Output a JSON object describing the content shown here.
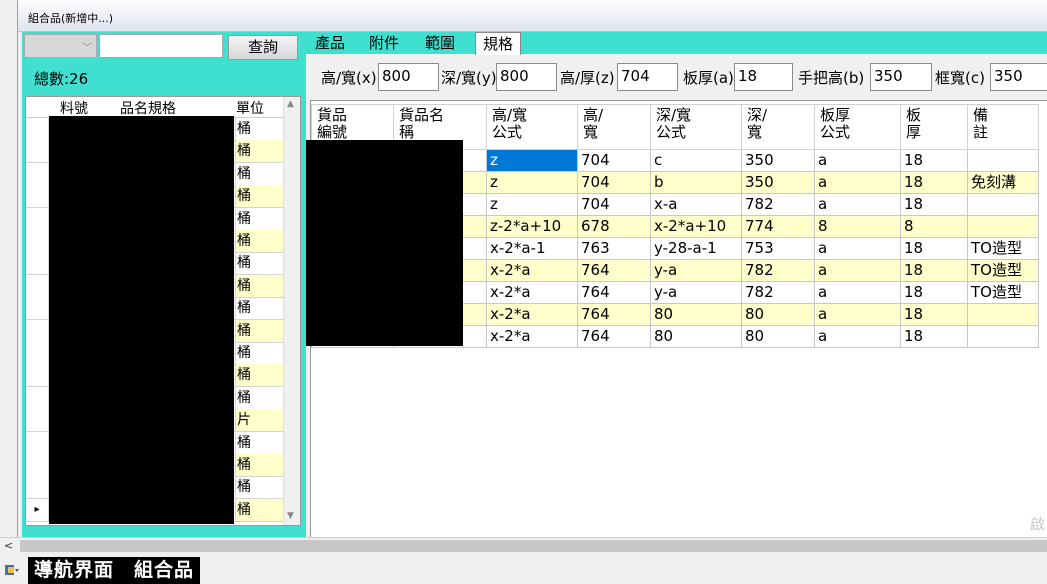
{
  "window": {
    "title": "組合品(新增中...)"
  },
  "left": {
    "combo_value": "",
    "search_value": "",
    "query_label": "查詢",
    "count_label": "總數:26",
    "columns": [
      "料號",
      "品名規格",
      "單位"
    ],
    "rows": [
      {
        "unit": "桶",
        "yellow": false
      },
      {
        "unit": "桶",
        "yellow": true
      },
      {
        "unit": "桶",
        "yellow": false
      },
      {
        "unit": "桶",
        "yellow": true
      },
      {
        "unit": "桶",
        "yellow": false
      },
      {
        "unit": "桶",
        "yellow": true
      },
      {
        "unit": "桶",
        "yellow": false
      },
      {
        "unit": "桶",
        "yellow": true
      },
      {
        "unit": "桶",
        "yellow": false
      },
      {
        "unit": "桶",
        "yellow": true
      },
      {
        "unit": "桶",
        "yellow": false
      },
      {
        "unit": "桶",
        "yellow": true
      },
      {
        "unit": "桶",
        "yellow": false
      },
      {
        "unit": "片",
        "yellow": true
      },
      {
        "unit": "桶",
        "yellow": false
      },
      {
        "unit": "桶",
        "yellow": true
      },
      {
        "unit": "桶",
        "yellow": false
      },
      {
        "unit": "桶",
        "yellow": true
      }
    ],
    "current_row_marker": "▸"
  },
  "tabs": [
    "產品",
    "附件",
    "範圍",
    "規格"
  ],
  "selected_tab": "規格",
  "params": {
    "height_label": "高/寬(x)",
    "height_value": "800",
    "depth_label": "深/寬(y)",
    "depth_value": "800",
    "thick_label": "高/厚(z)",
    "thick_value": "704",
    "board_label": "板厚(a)",
    "board_value": "18",
    "handle_label": "手把高(b)",
    "handle_value": "350",
    "frame_label": "框寬(c)",
    "frame_value": "350"
  },
  "grid": {
    "headers": [
      "貨品\n編號",
      "貨品名\n稱",
      "高/寬\n公式",
      "高/\n寬",
      "深/寬\n公式",
      "深/\n寬",
      "板厚\n公式",
      "板\n厚",
      "備\n註"
    ],
    "rows": [
      {
        "hf": "z",
        "h": "704",
        "df": "c",
        "d": "350",
        "bf": "a",
        "b": "18",
        "note": "",
        "yellow": false
      },
      {
        "hf": "z",
        "h": "704",
        "df": "b",
        "d": "350",
        "bf": "a",
        "b": "18",
        "note": "免刻溝",
        "yellow": true
      },
      {
        "hf": "z",
        "h": "704",
        "df": "x-a",
        "d": "782",
        "bf": "a",
        "b": "18",
        "note": "",
        "yellow": false
      },
      {
        "hf": "z-2*a+10",
        "h": "678",
        "df": "x-2*a+10",
        "d": "774",
        "bf": "8",
        "b": "8",
        "note": "",
        "yellow": true
      },
      {
        "hf": "x-2*a-1",
        "h": "763",
        "df": "y-28-a-1",
        "d": "753",
        "bf": "a",
        "b": "18",
        "note": "TO造型",
        "yellow": false
      },
      {
        "hf": "x-2*a",
        "h": "764",
        "df": "y-a",
        "d": "782",
        "bf": "a",
        "b": "18",
        "note": "TO造型",
        "yellow": true
      },
      {
        "hf": "x-2*a",
        "h": "764",
        "df": "y-a",
        "d": "782",
        "bf": "a",
        "b": "18",
        "note": "TO造型",
        "yellow": false
      },
      {
        "hf": "x-2*a",
        "h": "764",
        "df": "80",
        "d": "80",
        "bf": "a",
        "b": "18",
        "note": "",
        "yellow": true
      },
      {
        "hf": "x-2*a",
        "h": "764",
        "df": "80",
        "d": "80",
        "bf": "a",
        "b": "18",
        "note": "",
        "yellow": false
      }
    ]
  },
  "watermark": "啟\n移",
  "taskbar": {
    "nav_label": "導航界面　組合品"
  },
  "colors": {
    "accent": "#40e0d0",
    "row_alt": "#ffffcc",
    "selection": "#0078d7"
  }
}
